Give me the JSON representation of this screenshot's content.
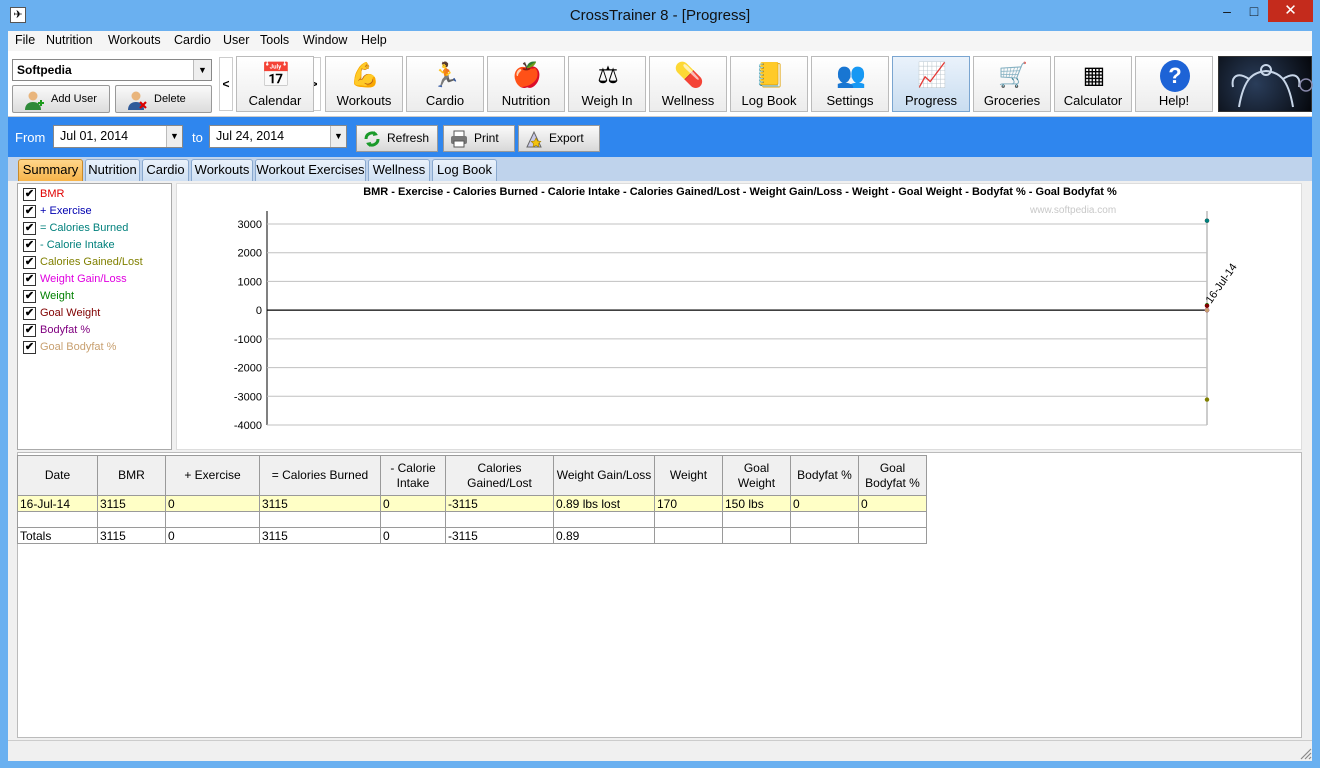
{
  "window": {
    "title": "CrossTrainer 8 - [Progress]",
    "min_glyph": "–",
    "max_glyph": "□",
    "close_glyph": "✕"
  },
  "menu": [
    "File",
    "Nutrition",
    "Workouts",
    "Cardio",
    "User",
    "Tools",
    "Window",
    "Help"
  ],
  "user": {
    "selected": "Softpedia",
    "add_label": "Add User",
    "delete_label": "Delete User"
  },
  "toolbar": {
    "prev_glyph": "<",
    "next_glyph": ">",
    "buttons": [
      {
        "label": "Calendar",
        "icon": "calendar-icon",
        "glyph": "📅"
      },
      {
        "label": "Workouts",
        "icon": "muscle-icon",
        "glyph": "💪"
      },
      {
        "label": "Cardio",
        "icon": "runner-icon",
        "glyph": "🏃"
      },
      {
        "label": "Nutrition",
        "icon": "apple-icon",
        "glyph": "🍎"
      },
      {
        "label": "Weigh In",
        "icon": "scale-icon",
        "glyph": "⚖"
      },
      {
        "label": "Wellness",
        "icon": "pill-icon",
        "glyph": "💊"
      },
      {
        "label": "Log Book",
        "icon": "book-icon",
        "glyph": "📒"
      },
      {
        "label": "Settings",
        "icon": "users-icon",
        "glyph": "👥"
      },
      {
        "label": "Progress",
        "icon": "chart-icon",
        "glyph": "📈"
      },
      {
        "label": "Groceries",
        "icon": "cart-icon",
        "glyph": "🛒"
      },
      {
        "label": "Calculator",
        "icon": "calculator-icon",
        "glyph": "▦"
      },
      {
        "label": "Help!",
        "icon": "help-icon",
        "glyph": "?"
      }
    ]
  },
  "range": {
    "from_label": "From",
    "from_value": "Jul  01, 2014",
    "to_label": "to",
    "to_value": "Jul  24, 2014"
  },
  "actions": {
    "refresh": "Refresh",
    "print": "Print",
    "export": "Export"
  },
  "tabs": [
    "Summary",
    "Nutrition",
    "Cardio",
    "Workouts",
    "Workout Exercises",
    "Wellness",
    "Log Book"
  ],
  "active_tab": "Summary",
  "legend": [
    {
      "label": "BMR",
      "color": "#e00000"
    },
    {
      "label": "+ Exercise",
      "color": "#0000b0"
    },
    {
      "label": "= Calories Burned",
      "color": "#00807c"
    },
    {
      "label": "- Calorie Intake",
      "color": "#00807c"
    },
    {
      "label": "Calories Gained/Lost",
      "color": "#808000"
    },
    {
      "label": "Weight Gain/Loss",
      "color": "#e000e0"
    },
    {
      "label": "Weight",
      "color": "#008000"
    },
    {
      "label": "Goal Weight",
      "color": "#800000"
    },
    {
      "label": "Bodyfat %",
      "color": "#800080"
    },
    {
      "label": "Goal Bodyfat %",
      "color": "#c8a070"
    }
  ],
  "check_glyph": "✔",
  "watermark": "www.softpedia.com",
  "chart_data": {
    "type": "line",
    "title": "BMR -  Exercise -  Calories Burned -  Calorie Intake - Calories Gained/Lost - Weight Gain/Loss - Weight - Goal Weight - Bodyfat % - Goal Bodyfat %",
    "categories": [
      "16-Jul-14"
    ],
    "ylim": [
      -4000,
      3000
    ],
    "yticks": [
      3000,
      2000,
      1000,
      0,
      -1000,
      -2000,
      -3000,
      -4000
    ],
    "grid": true,
    "legend_placement": "left-panel",
    "series": [
      {
        "name": "BMR",
        "color": "#e00000",
        "values": [
          3115
        ]
      },
      {
        "name": "+ Exercise",
        "color": "#0000b0",
        "values": [
          0
        ]
      },
      {
        "name": "= Calories Burned",
        "color": "#00807c",
        "values": [
          3115
        ]
      },
      {
        "name": "- Calorie Intake",
        "color": "#00807c",
        "values": [
          0
        ]
      },
      {
        "name": "Calories Gained/Lost",
        "color": "#808000",
        "values": [
          -3115
        ]
      },
      {
        "name": "Weight Gain/Loss",
        "color": "#e000e0",
        "values": [
          0.89
        ]
      },
      {
        "name": "Weight",
        "color": "#008000",
        "values": [
          170
        ]
      },
      {
        "name": "Goal Weight",
        "color": "#800000",
        "values": [
          150
        ]
      },
      {
        "name": "Bodyfat %",
        "color": "#800080",
        "values": [
          0
        ]
      },
      {
        "name": "Goal Bodyfat %",
        "color": "#c8a070",
        "values": [
          0
        ]
      }
    ]
  },
  "table": {
    "headers": [
      "Date",
      "BMR",
      "+ Exercise",
      "= Calories Burned",
      "- Calorie Intake",
      "Calories Gained/Lost",
      "Weight Gain/Loss",
      "Weight",
      "Goal Weight",
      "Bodyfat %",
      "Goal Bodyfat %"
    ],
    "rows": [
      [
        "16-Jul-14",
        "3115",
        "0",
        "3115",
        "0",
        "-3115",
        "0.89 lbs lost",
        "170",
        "150 lbs",
        "0",
        "0"
      ],
      [
        "",
        "",
        "",
        "",
        "",
        "",
        "",
        "",
        "",
        "",
        ""
      ],
      [
        "Totals",
        "3115",
        "0",
        "3115",
        "0",
        "-3115",
        "0.89",
        "",
        "",
        "",
        ""
      ]
    ]
  }
}
